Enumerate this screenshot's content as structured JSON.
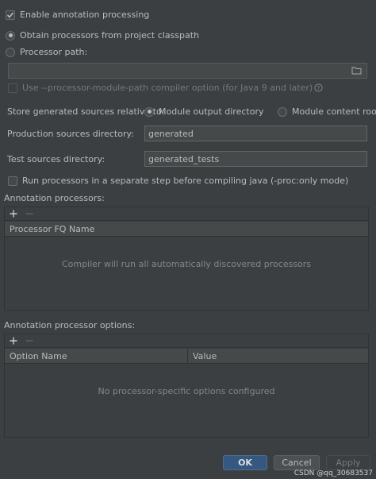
{
  "options": {
    "enable_annotation_processing": {
      "label": "Enable annotation processing",
      "checked": true
    },
    "obtain_from_classpath": {
      "label": "Obtain processors from project classpath",
      "selected": true
    },
    "processor_path": {
      "label": "Processor path:",
      "selected": false,
      "value": ""
    },
    "module_path_option": {
      "label": "Use --processor-module-path compiler option (for Java 9 and later)",
      "checked": false,
      "enabled": false
    },
    "store_relative_label": "Store generated sources relative to:",
    "module_output_dir": {
      "label": "Module output directory",
      "selected": true
    },
    "module_content_root": {
      "label": "Module content root",
      "selected": false
    },
    "production_sources_label": "Production sources directory:",
    "production_sources_value": "generated",
    "test_sources_label": "Test sources directory:",
    "test_sources_value": "generated_tests",
    "separate_step": {
      "label": "Run processors in a separate step before compiling java (-proc:only mode)",
      "checked": false
    }
  },
  "processors": {
    "section_label": "Annotation processors:",
    "column": "Processor FQ Name",
    "empty_text": "Compiler will run all automatically discovered processors"
  },
  "processor_options": {
    "section_label": "Annotation processor options:",
    "columns": [
      "Option Name",
      "Value"
    ],
    "empty_text": "No processor-specific options configured"
  },
  "buttons": {
    "ok": "OK",
    "cancel": "Cancel",
    "apply": "Apply"
  },
  "watermark": "CSDN @qq_30683537",
  "colors": {
    "background": "#3c3f41",
    "primary_button": "#365880",
    "text": "#bbbbbb"
  }
}
